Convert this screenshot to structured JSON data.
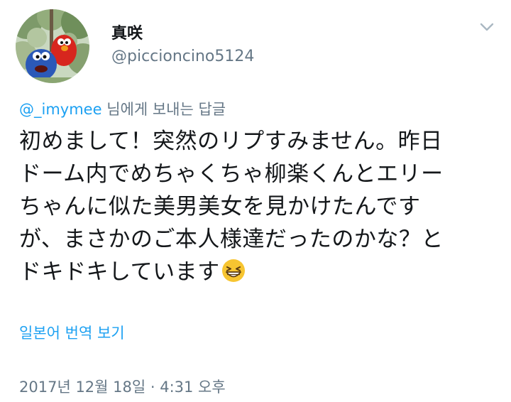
{
  "author": {
    "display_name": "真咲",
    "handle": "@piccioncino5124",
    "avatar_icon": "avatar-elmo-tree-icon"
  },
  "menu": {
    "icon": "chevron-down-icon"
  },
  "reply": {
    "mention": "@_imymee",
    "suffix": " 님에게 보내는 답글"
  },
  "tweet": {
    "lines": [
      "初めまして！突然のリプすみません。昨日",
      "ドーム内でめちゃくちゃ柳楽くんとエリー",
      "ちゃんに似た美男美女を見かけたんです",
      "が、まさかのご本人様達だったのかな？と",
      "ドキドキしています"
    ],
    "emoji": "grinning-squinting-face-emoji"
  },
  "translate_label": "일본어 번역 보기",
  "timestamp": "2017년 12월 18일 · 4:31 오후",
  "colors": {
    "link": "#1da1f2",
    "secondary_text": "#657786",
    "primary_text": "#14171a"
  }
}
